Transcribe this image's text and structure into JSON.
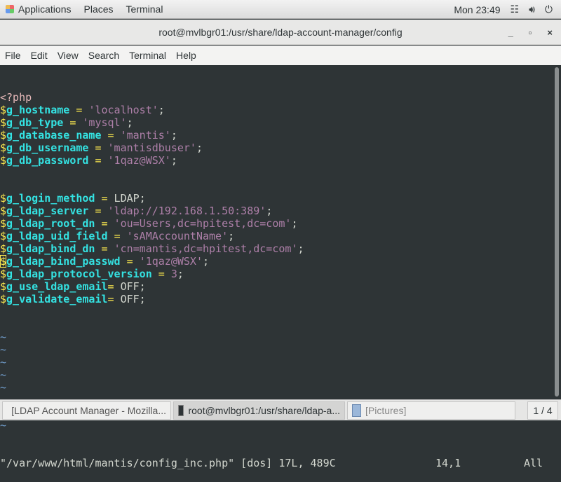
{
  "topbar": {
    "menus": [
      "Applications",
      "Places",
      "Terminal"
    ],
    "clock": "Mon 23:49",
    "icons": [
      "network-icon",
      "volume-icon",
      "power-icon"
    ]
  },
  "window": {
    "title": "root@mvlbgr01:/usr/share/ldap-account-manager/config",
    "controls": [
      "_",
      "▫",
      "×"
    ]
  },
  "menubar": [
    "File",
    "Edit",
    "View",
    "Search",
    "Terminal",
    "Help"
  ],
  "editor": {
    "lines": [
      [
        [
          "tag",
          "<?php"
        ]
      ],
      [
        [
          "dol",
          "$"
        ],
        [
          "var",
          "g_hostname"
        ],
        [
          "pl",
          " "
        ],
        [
          "op",
          "="
        ],
        [
          "pl",
          " "
        ],
        [
          "str",
          "'localhost'"
        ],
        [
          "pl",
          ";"
        ]
      ],
      [
        [
          "dol",
          "$"
        ],
        [
          "var",
          "g_db_type"
        ],
        [
          "pl",
          " "
        ],
        [
          "op",
          "="
        ],
        [
          "pl",
          " "
        ],
        [
          "str",
          "'mysql'"
        ],
        [
          "pl",
          ";"
        ]
      ],
      [
        [
          "dol",
          "$"
        ],
        [
          "var",
          "g_database_name"
        ],
        [
          "pl",
          " "
        ],
        [
          "op",
          "="
        ],
        [
          "pl",
          " "
        ],
        [
          "str",
          "'mantis'"
        ],
        [
          "pl",
          ";"
        ]
      ],
      [
        [
          "dol",
          "$"
        ],
        [
          "var",
          "g_db_username"
        ],
        [
          "pl",
          " "
        ],
        [
          "op",
          "="
        ],
        [
          "pl",
          " "
        ],
        [
          "str",
          "'mantisdbuser'"
        ],
        [
          "pl",
          ";"
        ]
      ],
      [
        [
          "dol",
          "$"
        ],
        [
          "var",
          "g_db_password"
        ],
        [
          "pl",
          " "
        ],
        [
          "op",
          "="
        ],
        [
          "pl",
          " "
        ],
        [
          "str",
          "'1qaz@WSX'"
        ],
        [
          "pl",
          ";"
        ]
      ],
      [],
      [],
      [
        [
          "dol",
          "$"
        ],
        [
          "var",
          "g_login_method"
        ],
        [
          "pl",
          " "
        ],
        [
          "op",
          "="
        ],
        [
          "pl",
          " LDAP;"
        ]
      ],
      [
        [
          "dol",
          "$"
        ],
        [
          "var",
          "g_ldap_server"
        ],
        [
          "pl",
          " "
        ],
        [
          "op",
          "="
        ],
        [
          "pl",
          " "
        ],
        [
          "str",
          "'ldap://192.168.1.50:389'"
        ],
        [
          "pl",
          ";"
        ]
      ],
      [
        [
          "dol",
          "$"
        ],
        [
          "var",
          "g_ldap_root_dn"
        ],
        [
          "pl",
          " "
        ],
        [
          "op",
          "="
        ],
        [
          "pl",
          " "
        ],
        [
          "str",
          "'ou=Users,dc=hpitest,dc=com'"
        ],
        [
          "pl",
          ";"
        ]
      ],
      [
        [
          "dol",
          "$"
        ],
        [
          "var",
          "g_ldap_uid_field"
        ],
        [
          "pl",
          " "
        ],
        [
          "op",
          "="
        ],
        [
          "pl",
          " "
        ],
        [
          "str",
          "'sAMAccountName'"
        ],
        [
          "pl",
          ";"
        ]
      ],
      [
        [
          "dol",
          "$"
        ],
        [
          "var",
          "g_ldap_bind_dn"
        ],
        [
          "pl",
          " "
        ],
        [
          "op",
          "="
        ],
        [
          "pl",
          " "
        ],
        [
          "str",
          "'cn=mantis,dc=hpitest,dc=com'"
        ],
        [
          "pl",
          ";"
        ]
      ],
      [
        [
          "dol cur",
          "$"
        ],
        [
          "var",
          "g_ldap_bind_passwd"
        ],
        [
          "pl",
          " "
        ],
        [
          "op",
          "="
        ],
        [
          "pl",
          " "
        ],
        [
          "str",
          "'1qaz@WSX'"
        ],
        [
          "pl",
          ";"
        ]
      ],
      [
        [
          "dol",
          "$"
        ],
        [
          "var",
          "g_ldap_protocol_version"
        ],
        [
          "pl",
          " "
        ],
        [
          "op",
          "="
        ],
        [
          "pl",
          " "
        ],
        [
          "num",
          "3"
        ],
        [
          "pl",
          ";"
        ]
      ],
      [
        [
          "dol",
          "$"
        ],
        [
          "var",
          "g_use_ldap_email"
        ],
        [
          "op",
          "="
        ],
        [
          "pl",
          " OFF;"
        ]
      ],
      [
        [
          "dol",
          "$"
        ],
        [
          "var",
          "g_validate_email"
        ],
        [
          "op",
          "="
        ],
        [
          "pl",
          " OFF;"
        ]
      ]
    ],
    "tilde_rows": 8,
    "status": {
      "file": "\"/var/www/html/mantis/config_inc.php\" [dos] 17L, 489C",
      "position": "14,1",
      "scroll": "All"
    }
  },
  "taskbar": {
    "tasks": [
      {
        "label": "[LDAP Account Manager - Mozilla...",
        "icon": "firefox-icon"
      },
      {
        "label": "root@mvlbgr01:/usr/share/ldap-a...",
        "icon": "terminal-icon",
        "active": true
      },
      {
        "label": "[Pictures]",
        "icon": "file-cabinet-icon"
      }
    ],
    "pager": "1 / 4"
  }
}
